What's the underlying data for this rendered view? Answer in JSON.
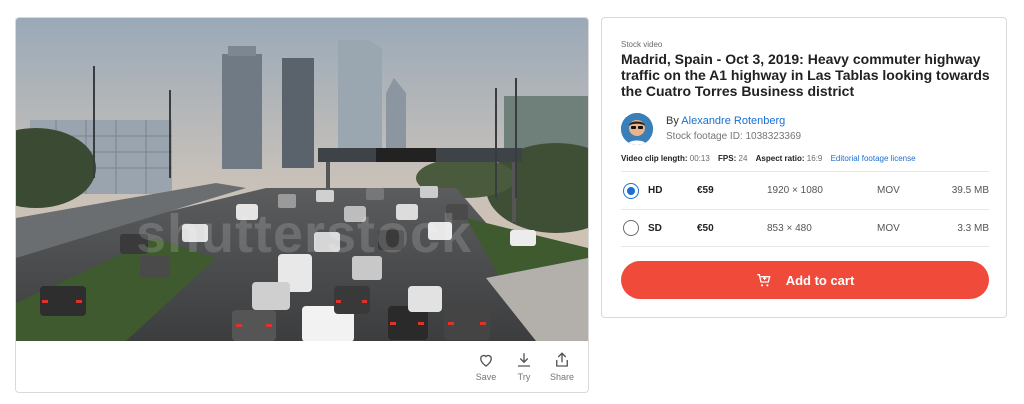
{
  "media": {
    "watermark": "shutterstock",
    "actions": [
      {
        "label": "Save",
        "icon": "heart-icon"
      },
      {
        "label": "Try",
        "icon": "download-icon"
      },
      {
        "label": "Share",
        "icon": "share-icon"
      }
    ]
  },
  "info": {
    "eyebrow": "Stock video",
    "title": "Madrid, Spain - Oct 3, 2019: Heavy commuter highway traffic on the A1 highway in Las Tablas looking towards the Cuatro Torres Business district",
    "by_prefix": "By",
    "contributor": "Alexandre Rotenberg",
    "stock_id": "Stock footage ID: 1038323369",
    "meta": {
      "length_label": "Video clip length:",
      "length_value": "00:13",
      "fps_label": "FPS:",
      "fps_value": "24",
      "aspect_label": "Aspect ratio:",
      "aspect_value": "16:9",
      "license_link": "Editorial footage license"
    },
    "options": [
      {
        "name": "HD",
        "price": "€59",
        "dimensions": "1920 × 1080",
        "format": "MOV",
        "size": "39.5 MB",
        "selected": true
      },
      {
        "name": "SD",
        "price": "€50",
        "dimensions": "853 × 480",
        "format": "MOV",
        "size": "3.3 MB",
        "selected": false
      }
    ],
    "cart_label": "Add to cart"
  },
  "colors": {
    "accent_red": "#f04a3b",
    "link_blue": "#1a6fd1"
  }
}
